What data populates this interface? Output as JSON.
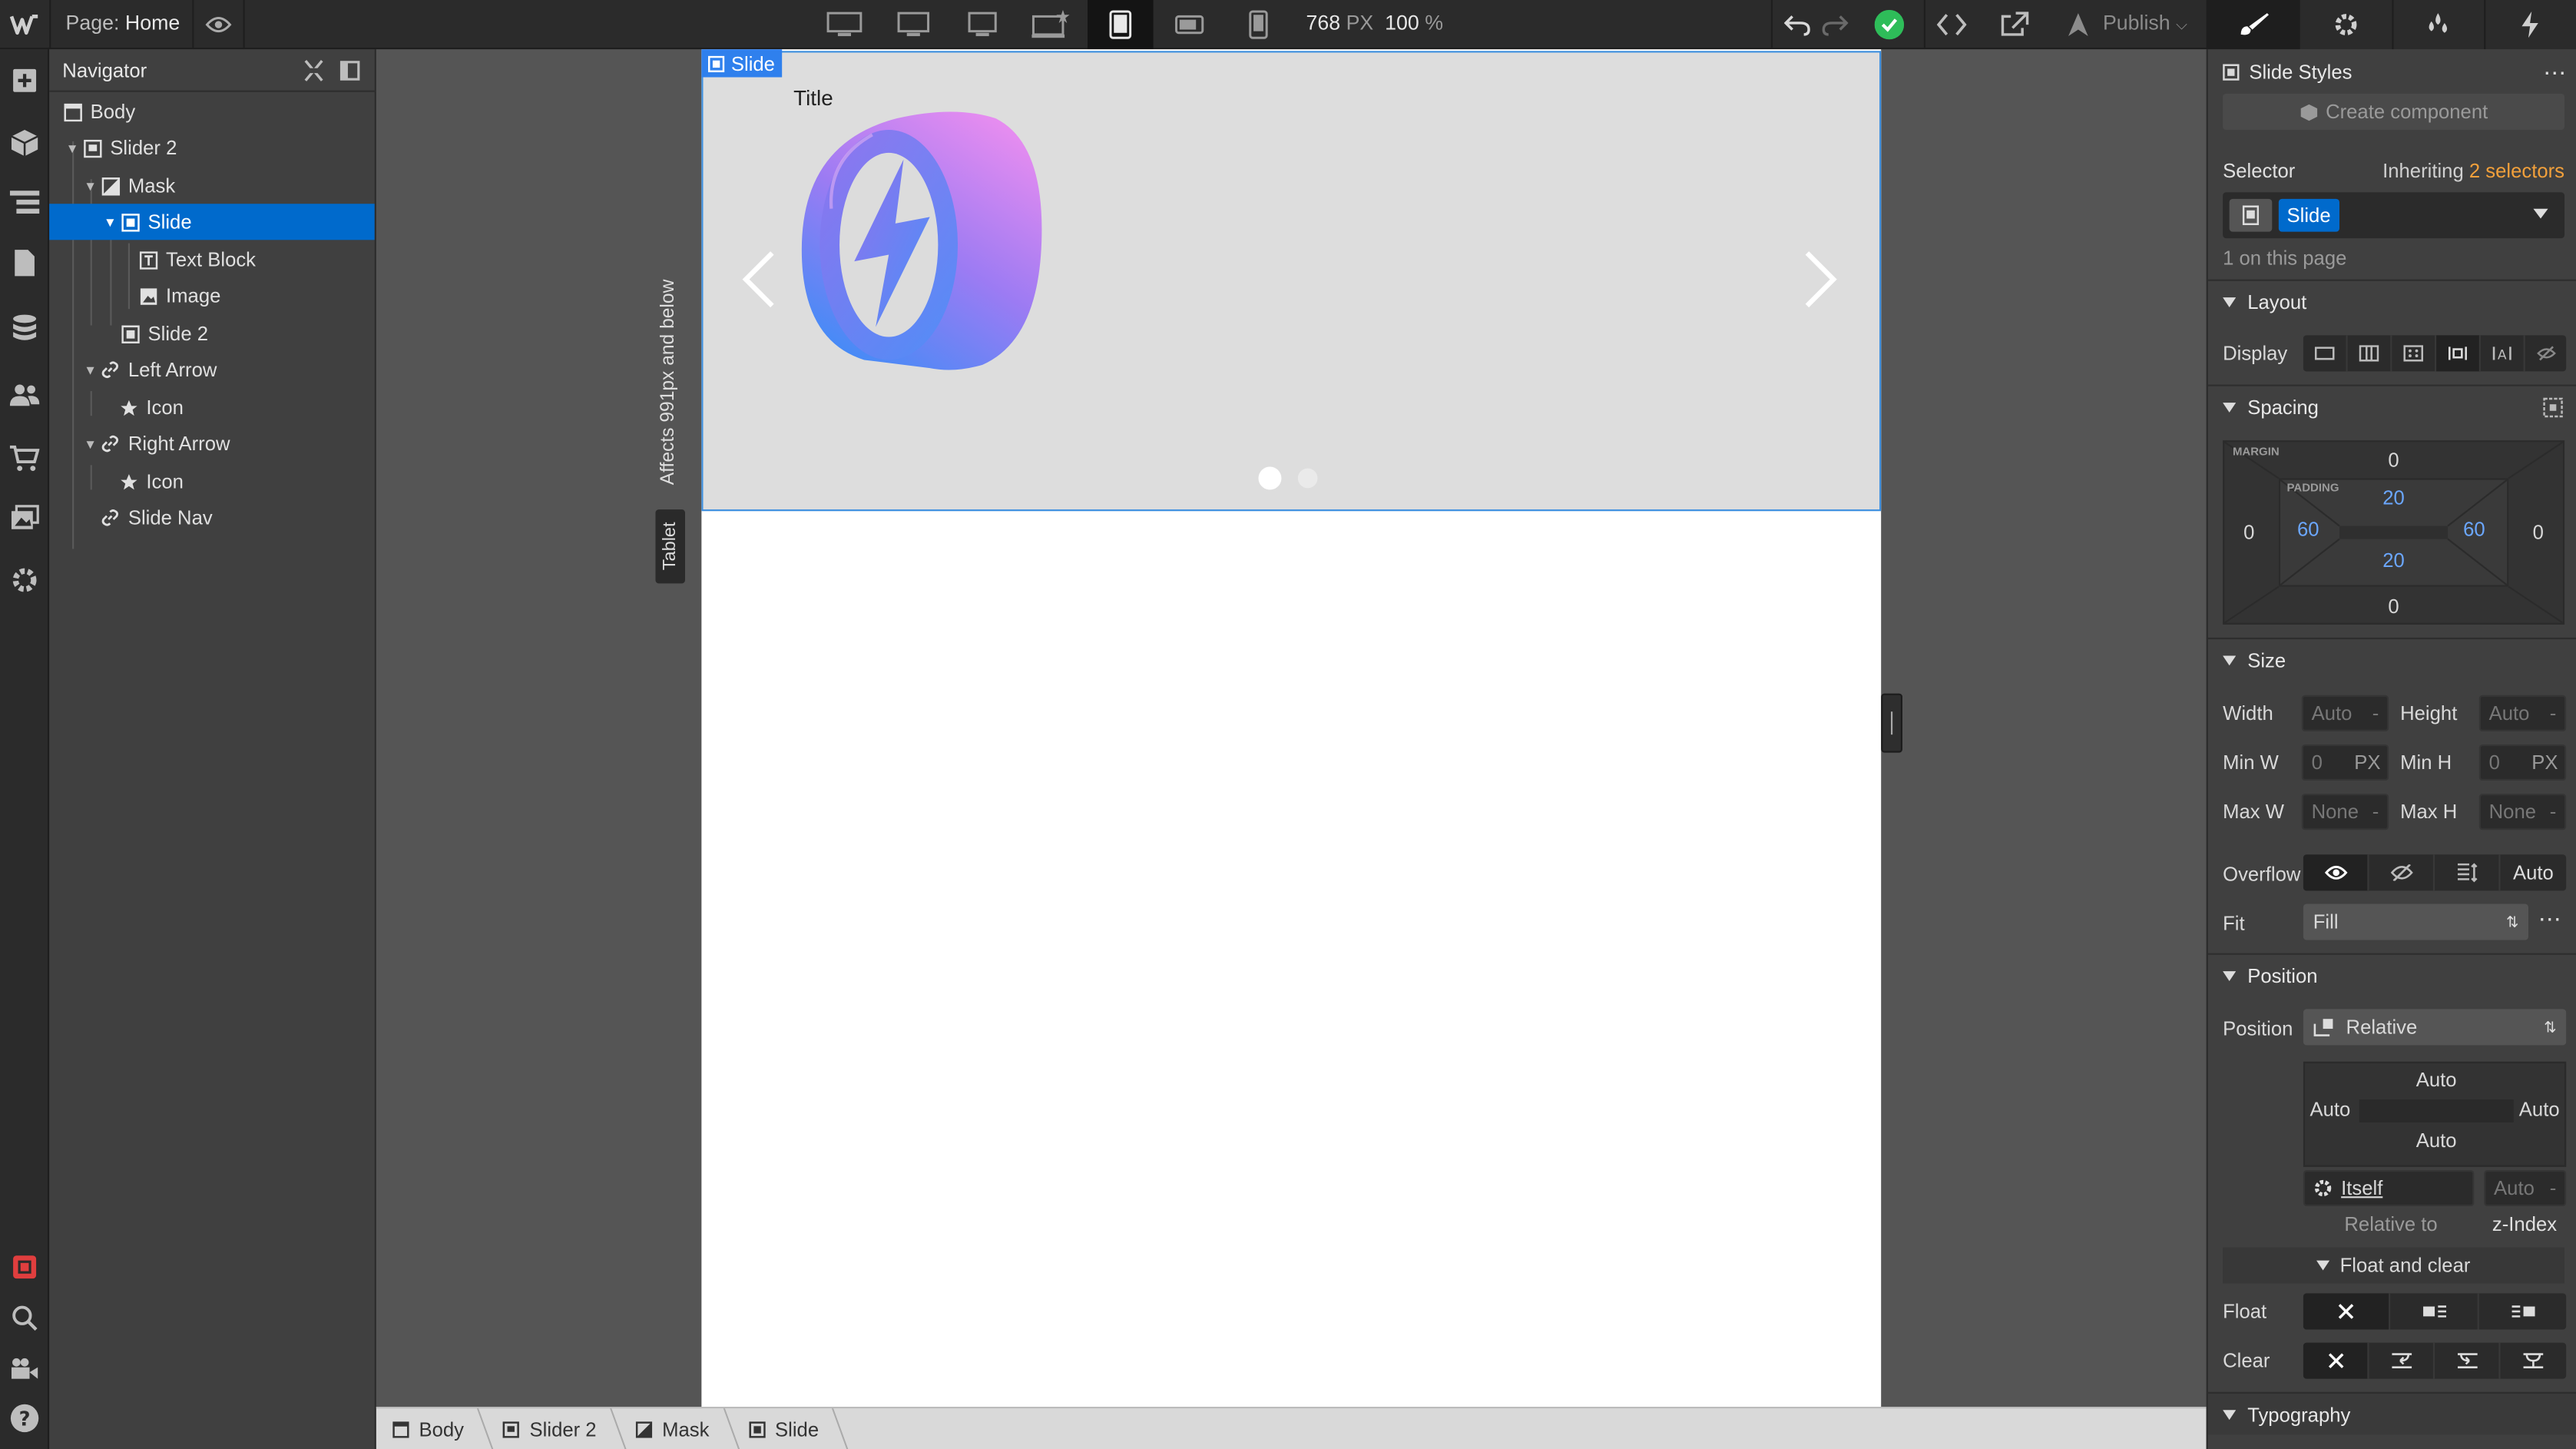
{
  "topbar": {
    "page_label": "Page:",
    "page_name": "Home",
    "canvas_width": "768",
    "canvas_width_unit": "PX",
    "zoom": "100",
    "zoom_unit": "%",
    "publish_label": "Publish"
  },
  "navigator": {
    "title": "Navigator",
    "items": [
      {
        "label": "Body"
      },
      {
        "label": "Slider 2"
      },
      {
        "label": "Mask"
      },
      {
        "label": "Slide"
      },
      {
        "label": "Text Block"
      },
      {
        "label": "Image"
      },
      {
        "label": "Slide 2"
      },
      {
        "label": "Left Arrow"
      },
      {
        "label": "Icon"
      },
      {
        "label": "Right Arrow"
      },
      {
        "label": "Icon"
      },
      {
        "label": "Slide Nav"
      }
    ]
  },
  "canvas": {
    "selected_tag": "Slide",
    "slide_title": "Title",
    "affects_note": "Affects 991px and below",
    "breakpoint_badge": "Tablet",
    "slide_dots": 2,
    "active_dot": 1
  },
  "breadcrumbs": [
    "Body",
    "Slider 2",
    "Mask",
    "Slide"
  ],
  "style_panel": {
    "header": "Slide Styles",
    "create_component": "Create component",
    "selector_label": "Selector",
    "inheriting_prefix": "Inheriting",
    "inheriting_count": "2 selectors",
    "selector_chip": "Slide",
    "on_page": "1 on this page",
    "layout": {
      "title": "Layout",
      "display_label": "Display"
    },
    "spacing": {
      "title": "Spacing",
      "margin_label": "MARGIN",
      "padding_label": "PADDING",
      "margin_top": "0",
      "margin_right": "0",
      "margin_bottom": "0",
      "margin_left": "0",
      "padding_top": "20",
      "padding_right": "60",
      "padding_bottom": "20",
      "padding_left": "60"
    },
    "size": {
      "title": "Size",
      "width_label": "Width",
      "width_value": "Auto",
      "height_label": "Height",
      "height_value": "Auto",
      "minw_label": "Min W",
      "minw_value": "0",
      "minw_unit": "PX",
      "minh_label": "Min H",
      "minh_value": "0",
      "minh_unit": "PX",
      "maxw_label": "Max W",
      "maxw_value": "None",
      "maxh_label": "Max H",
      "maxh_value": "None",
      "overflow_label": "Overflow",
      "overflow_auto": "Auto",
      "fit_label": "Fit",
      "fit_value": "Fill"
    },
    "position": {
      "title": "Position",
      "position_label": "Position",
      "position_value": "Relative",
      "top": "Auto",
      "left": "Auto",
      "right": "Auto",
      "bottom": "Auto",
      "relative_value": "Itself",
      "z_value": "Auto",
      "relative_label": "Relative to",
      "z_label": "z-Index",
      "float_clear_label": "Float and clear",
      "float_label": "Float",
      "clear_label": "Clear"
    },
    "typography": {
      "title": "Typography"
    }
  },
  "colors": {
    "accent": "#006acc",
    "success": "#2ebd59",
    "orange": "#f2a03b"
  }
}
